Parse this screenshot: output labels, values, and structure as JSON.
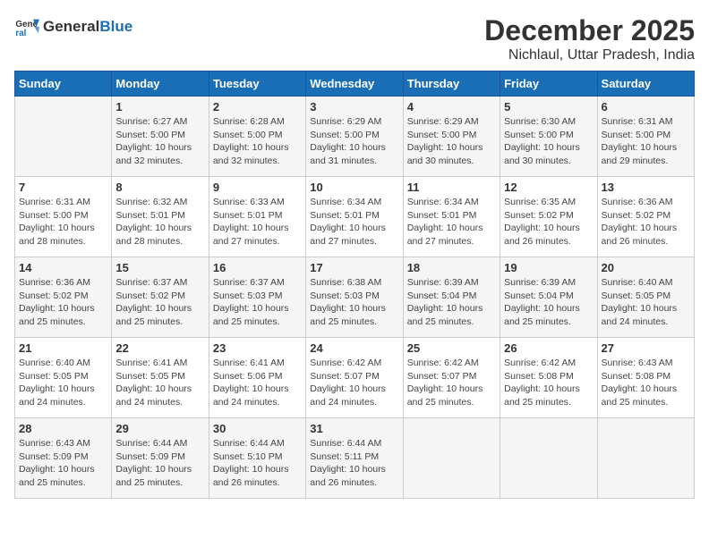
{
  "logo": {
    "general": "General",
    "blue": "Blue"
  },
  "title": "December 2025",
  "location": "Nichlaul, Uttar Pradesh, India",
  "headers": [
    "Sunday",
    "Monday",
    "Tuesday",
    "Wednesday",
    "Thursday",
    "Friday",
    "Saturday"
  ],
  "weeks": [
    [
      {
        "day": "",
        "info": ""
      },
      {
        "day": "1",
        "info": "Sunrise: 6:27 AM\nSunset: 5:00 PM\nDaylight: 10 hours and 32 minutes."
      },
      {
        "day": "2",
        "info": "Sunrise: 6:28 AM\nSunset: 5:00 PM\nDaylight: 10 hours and 32 minutes."
      },
      {
        "day": "3",
        "info": "Sunrise: 6:29 AM\nSunset: 5:00 PM\nDaylight: 10 hours and 31 minutes."
      },
      {
        "day": "4",
        "info": "Sunrise: 6:29 AM\nSunset: 5:00 PM\nDaylight: 10 hours and 30 minutes."
      },
      {
        "day": "5",
        "info": "Sunrise: 6:30 AM\nSunset: 5:00 PM\nDaylight: 10 hours and 30 minutes."
      },
      {
        "day": "6",
        "info": "Sunrise: 6:31 AM\nSunset: 5:00 PM\nDaylight: 10 hours and 29 minutes."
      }
    ],
    [
      {
        "day": "7",
        "info": "Sunrise: 6:31 AM\nSunset: 5:00 PM\nDaylight: 10 hours and 28 minutes."
      },
      {
        "day": "8",
        "info": "Sunrise: 6:32 AM\nSunset: 5:01 PM\nDaylight: 10 hours and 28 minutes."
      },
      {
        "day": "9",
        "info": "Sunrise: 6:33 AM\nSunset: 5:01 PM\nDaylight: 10 hours and 27 minutes."
      },
      {
        "day": "10",
        "info": "Sunrise: 6:34 AM\nSunset: 5:01 PM\nDaylight: 10 hours and 27 minutes."
      },
      {
        "day": "11",
        "info": "Sunrise: 6:34 AM\nSunset: 5:01 PM\nDaylight: 10 hours and 27 minutes."
      },
      {
        "day": "12",
        "info": "Sunrise: 6:35 AM\nSunset: 5:02 PM\nDaylight: 10 hours and 26 minutes."
      },
      {
        "day": "13",
        "info": "Sunrise: 6:36 AM\nSunset: 5:02 PM\nDaylight: 10 hours and 26 minutes."
      }
    ],
    [
      {
        "day": "14",
        "info": "Sunrise: 6:36 AM\nSunset: 5:02 PM\nDaylight: 10 hours and 25 minutes."
      },
      {
        "day": "15",
        "info": "Sunrise: 6:37 AM\nSunset: 5:02 PM\nDaylight: 10 hours and 25 minutes."
      },
      {
        "day": "16",
        "info": "Sunrise: 6:37 AM\nSunset: 5:03 PM\nDaylight: 10 hours and 25 minutes."
      },
      {
        "day": "17",
        "info": "Sunrise: 6:38 AM\nSunset: 5:03 PM\nDaylight: 10 hours and 25 minutes."
      },
      {
        "day": "18",
        "info": "Sunrise: 6:39 AM\nSunset: 5:04 PM\nDaylight: 10 hours and 25 minutes."
      },
      {
        "day": "19",
        "info": "Sunrise: 6:39 AM\nSunset: 5:04 PM\nDaylight: 10 hours and 25 minutes."
      },
      {
        "day": "20",
        "info": "Sunrise: 6:40 AM\nSunset: 5:05 PM\nDaylight: 10 hours and 24 minutes."
      }
    ],
    [
      {
        "day": "21",
        "info": "Sunrise: 6:40 AM\nSunset: 5:05 PM\nDaylight: 10 hours and 24 minutes."
      },
      {
        "day": "22",
        "info": "Sunrise: 6:41 AM\nSunset: 5:05 PM\nDaylight: 10 hours and 24 minutes."
      },
      {
        "day": "23",
        "info": "Sunrise: 6:41 AM\nSunset: 5:06 PM\nDaylight: 10 hours and 24 minutes."
      },
      {
        "day": "24",
        "info": "Sunrise: 6:42 AM\nSunset: 5:07 PM\nDaylight: 10 hours and 24 minutes."
      },
      {
        "day": "25",
        "info": "Sunrise: 6:42 AM\nSunset: 5:07 PM\nDaylight: 10 hours and 25 minutes."
      },
      {
        "day": "26",
        "info": "Sunrise: 6:42 AM\nSunset: 5:08 PM\nDaylight: 10 hours and 25 minutes."
      },
      {
        "day": "27",
        "info": "Sunrise: 6:43 AM\nSunset: 5:08 PM\nDaylight: 10 hours and 25 minutes."
      }
    ],
    [
      {
        "day": "28",
        "info": "Sunrise: 6:43 AM\nSunset: 5:09 PM\nDaylight: 10 hours and 25 minutes."
      },
      {
        "day": "29",
        "info": "Sunrise: 6:44 AM\nSunset: 5:09 PM\nDaylight: 10 hours and 25 minutes."
      },
      {
        "day": "30",
        "info": "Sunrise: 6:44 AM\nSunset: 5:10 PM\nDaylight: 10 hours and 26 minutes."
      },
      {
        "day": "31",
        "info": "Sunrise: 6:44 AM\nSunset: 5:11 PM\nDaylight: 10 hours and 26 minutes."
      },
      {
        "day": "",
        "info": ""
      },
      {
        "day": "",
        "info": ""
      },
      {
        "day": "",
        "info": ""
      }
    ]
  ]
}
